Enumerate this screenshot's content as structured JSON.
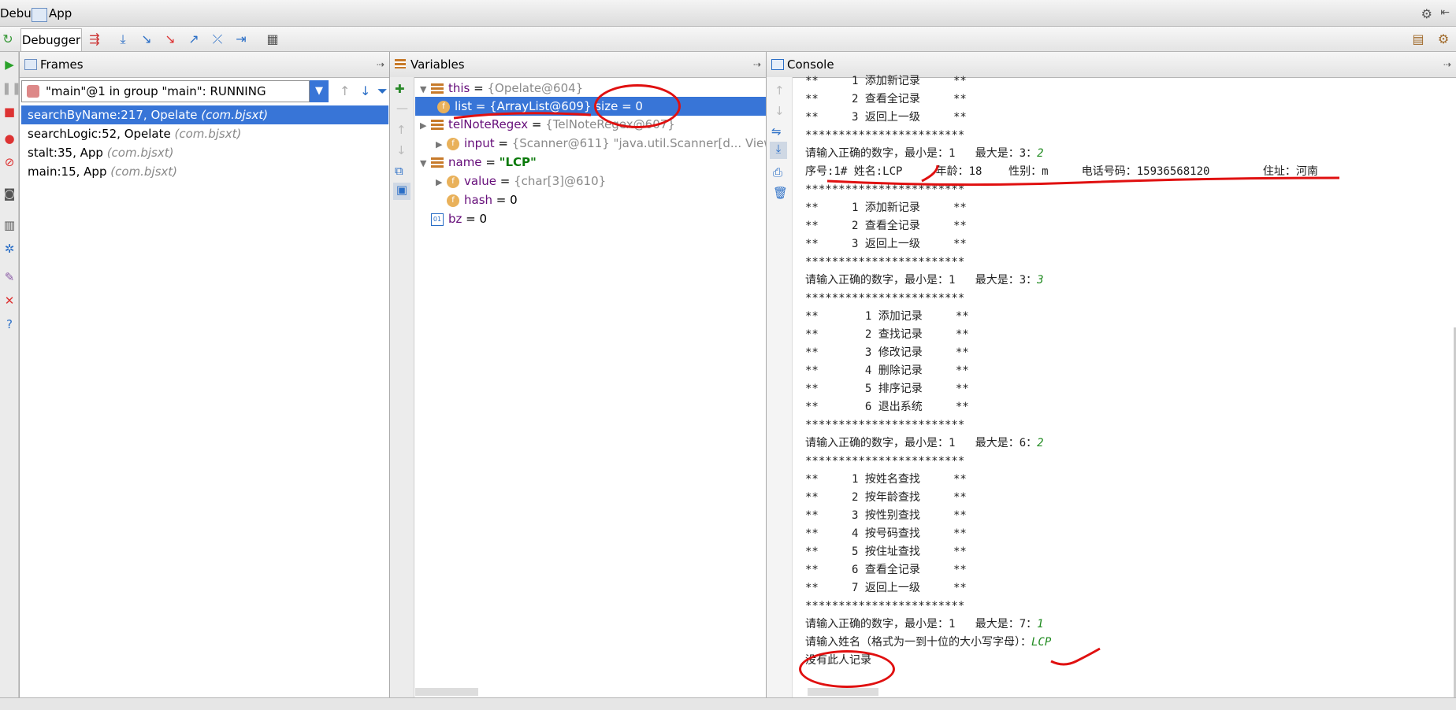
{
  "titlebar": {
    "debug": "Debug",
    "config": "App"
  },
  "toolbar": {
    "debugger_tab": "Debugger"
  },
  "frames": {
    "title": "Frames",
    "thread": "\"main\"@1 in group \"main\": RUNNING",
    "rows": [
      {
        "method": "searchByName:217, Opelate",
        "pkg": "(com.bjsxt)",
        "selected": true
      },
      {
        "method": "searchLogic:52, Opelate",
        "pkg": "(com.bjsxt)",
        "selected": false
      },
      {
        "method": "stalt:35, App",
        "pkg": "(com.bjsxt)",
        "selected": false
      },
      {
        "method": "main:15, App",
        "pkg": "(com.bjsxt)",
        "selected": false
      }
    ]
  },
  "variables": {
    "title": "Variables",
    "this_name": "this",
    "this_val": "{Opelate@604}",
    "list_name": "list",
    "list_val": "{ArrayList@609}  size = 0",
    "tel_name": "telNoteRegex",
    "tel_val": "{TelNoteRegex@607}",
    "input_name": "input",
    "input_val": "{Scanner@611} \"java.util.Scanner[d",
    "input_more": "... View",
    "name_name": "name",
    "name_val": "\"LCP\"",
    "value_name": "value",
    "value_val": "{char[3]@610}",
    "hash_name": "hash",
    "hash_val": "0",
    "bz_name": "bz",
    "bz_val": "0"
  },
  "console": {
    "title": "Console",
    "lines": [
      {
        "t": "**     1 添加新记录     **"
      },
      {
        "t": "**     2 查看全记录     **"
      },
      {
        "t": "**     3 返回上一级     **"
      },
      {
        "t": "************************"
      },
      {
        "t": "请输入正确的数字，最小是：1   最大是：3：",
        "in": "2"
      },
      {
        "t": "序号:1# 姓名:LCP     年龄：18    性别：m     电话号码：15936568120        住址：河南"
      },
      {
        "t": "************************"
      },
      {
        "t": "**     1 添加新记录     **"
      },
      {
        "t": "**     2 查看全记录     **"
      },
      {
        "t": "**     3 返回上一级     **"
      },
      {
        "t": "************************"
      },
      {
        "t": "请输入正确的数字，最小是：1   最大是：3：",
        "in": "3"
      },
      {
        "t": "************************"
      },
      {
        "t": "**       1 添加记录     **"
      },
      {
        "t": "**       2 查找记录     **"
      },
      {
        "t": "**       3 修改记录     **"
      },
      {
        "t": "**       4 删除记录     **"
      },
      {
        "t": "**       5 排序记录     **"
      },
      {
        "t": "**       6 退出系统     **"
      },
      {
        "t": "************************"
      },
      {
        "t": "请输入正确的数字，最小是：1   最大是：6：",
        "in": "2"
      },
      {
        "t": "************************"
      },
      {
        "t": "**     1 按姓名查找     **"
      },
      {
        "t": "**     2 按年龄查找     **"
      },
      {
        "t": "**     3 按性别查找     **"
      },
      {
        "t": "**     4 按号码查找     **"
      },
      {
        "t": "**     5 按住址查找     **"
      },
      {
        "t": "**     6 查看全记录     **"
      },
      {
        "t": "**     7 返回上一级     **"
      },
      {
        "t": "************************"
      },
      {
        "t": "请输入正确的数字，最小是：1   最大是：7：",
        "in": "1"
      },
      {
        "t": "请输入姓名（格式为一到十位的大小写字母）：",
        "in": "LCP"
      },
      {
        "t": "没有此人记录"
      }
    ]
  },
  "colors": {
    "selection": "#3875d7",
    "annotation": "#e01010",
    "input_text": "#1f8a1f"
  }
}
